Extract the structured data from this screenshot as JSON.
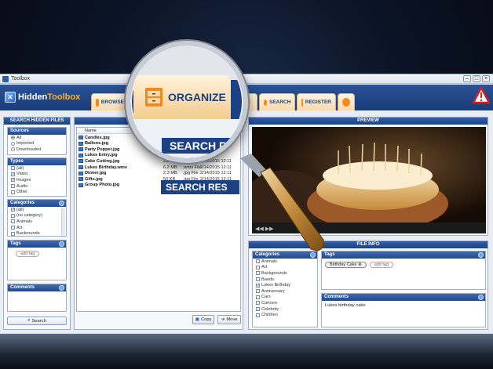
{
  "window": {
    "title": "Toolbox"
  },
  "header": {
    "logo_text_1": "Hidden",
    "logo_text_2": "Toolbox",
    "tabs": [
      {
        "label": "BROWSE",
        "icon": "browse-icon"
      },
      {
        "label": "ORGANIZE",
        "icon": "cabinet-icon"
      },
      {
        "label": "DS",
        "icon": "downloads-icon"
      },
      {
        "label": "SEARCH",
        "icon": "search-icon"
      },
      {
        "label": "REGISTER",
        "icon": "register-icon"
      },
      {
        "label": "",
        "icon": "gear-icon"
      }
    ],
    "warning_icon": "warning-icon"
  },
  "left": {
    "title": "SEARCH HIDDEN FILES",
    "sources": {
      "title": "Sources",
      "options": [
        "All",
        "Imported",
        "Downloaded"
      ],
      "selected": "All"
    },
    "types": {
      "title": "Types",
      "options": [
        {
          "label": "(all)",
          "checked": false
        },
        {
          "label": "Video",
          "checked": true
        },
        {
          "label": "Images",
          "checked": true
        },
        {
          "label": "Audio",
          "checked": false
        },
        {
          "label": "Other",
          "checked": false
        }
      ]
    },
    "categories": {
      "title": "Categories",
      "options": [
        {
          "label": "(all)",
          "checked": true
        },
        {
          "label": "(no category)",
          "checked": false
        },
        {
          "label": "Animals",
          "checked": false
        },
        {
          "label": "Art",
          "checked": false
        },
        {
          "label": "Backrounds",
          "checked": false
        }
      ]
    },
    "tags": {
      "title": "Tags",
      "add_label": "add tag"
    },
    "comments": {
      "title": "Comments"
    },
    "search_button": "Search"
  },
  "middle": {
    "title": "SEARCH RES",
    "magnified_title": "SEARCH RES",
    "column_name": "Name",
    "files": [
      {
        "name": "Candles.jpg",
        "size": "",
        "type": "",
        "date": ""
      },
      {
        "name": "Ballons.jpg",
        "size": "",
        "type": "",
        "date": ""
      },
      {
        "name": "Party Popper.jpg",
        "size": "",
        "type": "",
        "date": ""
      },
      {
        "name": "Lukes Entry.jpg",
        "size": "",
        "type": "",
        "date": ""
      },
      {
        "name": "Cake Cutting.jpg",
        "size": "2.8 MB",
        "type": ".jpg File",
        "date": "2/14/2015 12:11"
      },
      {
        "name": "Lukes Birthday.wmv",
        "size": "6.2 MB",
        "type": ".wmv File",
        "date": "2/14/2015 12:11"
      },
      {
        "name": "Dinner.jpg",
        "size": "2.3 MB",
        "type": ".jpg File",
        "date": "2/14/2015 12:11"
      },
      {
        "name": "Gifts.jpg",
        "size": "50 KB",
        "type": ".jpg File",
        "date": "2/14/2015 12:11"
      },
      {
        "name": "Group Photo.jpg",
        "size": "2.3 MB",
        "type": ".jpg File",
        "date": "2/14/2015 12:11"
      }
    ],
    "copy_button": "Copy",
    "move_button": "Move"
  },
  "preview": {
    "title": "PREVIEW"
  },
  "fileinfo": {
    "title": "FILE INFO",
    "categories": {
      "title": "Categories",
      "options": [
        {
          "label": "Animals",
          "checked": false
        },
        {
          "label": "Art",
          "checked": false
        },
        {
          "label": "Backgrounds",
          "checked": false
        },
        {
          "label": "Bands",
          "checked": false
        },
        {
          "label": "Lukes Birthday",
          "checked": true
        },
        {
          "label": "Anniversary",
          "checked": false
        },
        {
          "label": "Cars",
          "checked": false
        },
        {
          "label": "Cartoon",
          "checked": false
        },
        {
          "label": "Celebrity",
          "checked": false
        },
        {
          "label": "Children",
          "checked": false
        }
      ]
    },
    "tags": {
      "title": "Tags",
      "tag": "Birthday Cake",
      "add_label": "add tag"
    },
    "comments": {
      "title": "Comments",
      "text": "Lukes birthday cake"
    }
  },
  "colors": {
    "header": "#1d4284",
    "accent": "#f08a1d",
    "warning": "#d81f1f"
  }
}
